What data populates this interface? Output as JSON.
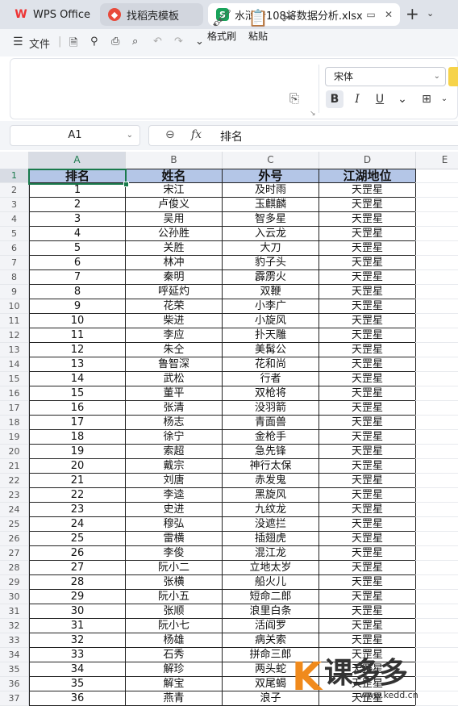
{
  "tabs": {
    "wps": "WPS Office",
    "template": "找稻壳模板",
    "doc": "水浒传108将数据分析.xlsx"
  },
  "menu": {
    "file": "文件"
  },
  "ribbon": {
    "format_painter": "格式刷",
    "paste": "粘贴",
    "font_name": "宋体",
    "bold": "B",
    "italic": "I",
    "underline": "U"
  },
  "formula": {
    "cell_ref": "A1",
    "fx": "fx",
    "value": "排名"
  },
  "sheet": {
    "columns": [
      "A",
      "B",
      "C",
      "D",
      "E"
    ],
    "header": [
      "排名",
      "姓名",
      "外号",
      "江湖地位"
    ],
    "rows": [
      [
        "1",
        "宋江",
        "及时雨",
        "天罡星"
      ],
      [
        "2",
        "卢俊义",
        "玉麒麟",
        "天罡星"
      ],
      [
        "3",
        "吴用",
        "智多星",
        "天罡星"
      ],
      [
        "4",
        "公孙胜",
        "入云龙",
        "天罡星"
      ],
      [
        "5",
        "关胜",
        "大刀",
        "天罡星"
      ],
      [
        "6",
        "林冲",
        "豹子头",
        "天罡星"
      ],
      [
        "7",
        "秦明",
        "霹雳火",
        "天罡星"
      ],
      [
        "8",
        "呼延灼",
        "双鞭",
        "天罡星"
      ],
      [
        "9",
        "花荣",
        "小李广",
        "天罡星"
      ],
      [
        "10",
        "柴进",
        "小旋风",
        "天罡星"
      ],
      [
        "11",
        "李应",
        "扑天雕",
        "天罡星"
      ],
      [
        "12",
        "朱仝",
        "美髯公",
        "天罡星"
      ],
      [
        "13",
        "鲁智深",
        "花和尚",
        "天罡星"
      ],
      [
        "14",
        "武松",
        "行者",
        "天罡星"
      ],
      [
        "15",
        "董平",
        "双枪将",
        "天罡星"
      ],
      [
        "16",
        "张清",
        "没羽箭",
        "天罡星"
      ],
      [
        "17",
        "杨志",
        "青面兽",
        "天罡星"
      ],
      [
        "18",
        "徐宁",
        "金枪手",
        "天罡星"
      ],
      [
        "19",
        "索超",
        "急先锋",
        "天罡星"
      ],
      [
        "20",
        "戴宗",
        "神行太保",
        "天罡星"
      ],
      [
        "21",
        "刘唐",
        "赤发鬼",
        "天罡星"
      ],
      [
        "22",
        "李逵",
        "黑旋风",
        "天罡星"
      ],
      [
        "23",
        "史进",
        "九纹龙",
        "天罡星"
      ],
      [
        "24",
        "穆弘",
        "没遮拦",
        "天罡星"
      ],
      [
        "25",
        "雷横",
        "插翅虎",
        "天罡星"
      ],
      [
        "26",
        "李俊",
        "混江龙",
        "天罡星"
      ],
      [
        "27",
        "阮小二",
        "立地太岁",
        "天罡星"
      ],
      [
        "28",
        "张横",
        "船火儿",
        "天罡星"
      ],
      [
        "29",
        "阮小五",
        "短命二郎",
        "天罡星"
      ],
      [
        "30",
        "张顺",
        "浪里白条",
        "天罡星"
      ],
      [
        "31",
        "阮小七",
        "活阎罗",
        "天罡星"
      ],
      [
        "32",
        "杨雄",
        "病关索",
        "天罡星"
      ],
      [
        "33",
        "石秀",
        "拼命三郎",
        "天罡星"
      ],
      [
        "34",
        "解珍",
        "两头蛇",
        "天罡星"
      ],
      [
        "35",
        "解宝",
        "双尾蝎",
        "天罡星"
      ],
      [
        "36",
        "燕青",
        "浪子",
        "天罡星"
      ]
    ]
  },
  "watermark": {
    "brand": "课多多",
    "url": "www.kedd.cn"
  },
  "colors": {
    "header_fill": "#b4c6e7",
    "selection": "#1a7a4c",
    "accent_orange": "#f08a1c"
  }
}
